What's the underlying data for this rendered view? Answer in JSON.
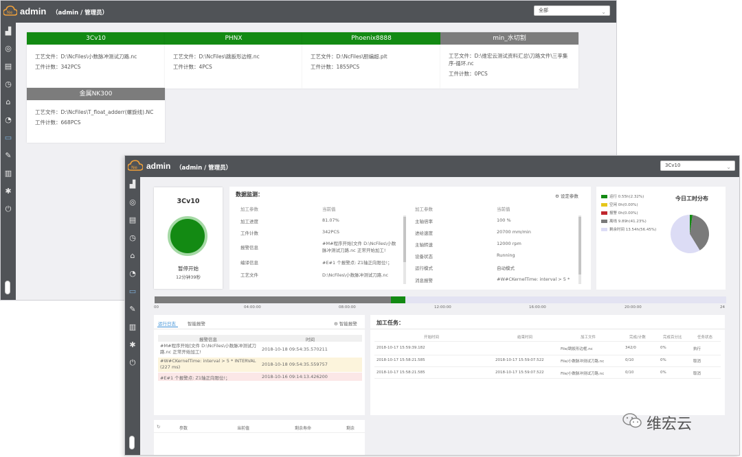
{
  "back": {
    "brand": "admin",
    "user_role": "（admin / 管理员）",
    "filter_value": "全部",
    "machines": [
      {
        "name": "3Cv10",
        "color": "#138a13",
        "file": "工艺文件：D:\\NcFiles\\小数脉冲测试刀路.nc",
        "count": "工件计数：342PCS"
      },
      {
        "name": "PHNX",
        "color": "#138a13",
        "file": "工艺文件：D:\\NcFiles\\跳扳形边框.nc",
        "count": "工件计数：4PCS"
      },
      {
        "name": "Phoenix8888",
        "color": "#138a13",
        "file": "工艺文件：D:\\NcFiles\\胆编超.plt",
        "count": "工件计数：1855PCS"
      },
      {
        "name": "min_水切割",
        "color": "#7c7c7c",
        "file": "工艺文件：D:\\维宏云测试资料汇总\\刀路文件\\三孪集序-循环.nc",
        "count": "工件计数：0PCS"
      },
      {
        "name": "金属NK300",
        "color": "#7c7c7c",
        "file": "工艺文件：D:\\NcFiles\\T_float_adderr(螺旋线).NC",
        "count": "工件计数：668PCS"
      }
    ]
  },
  "front": {
    "brand": "admin",
    "user_role": "（admin / 管理员）",
    "machine_select": "3Cv10",
    "machine_name": "3Cv10",
    "status_text": "暂停开始",
    "status_time": "12分钟39秒",
    "status_color": "#138a13",
    "monitor_title": "数据监测：",
    "settings_label": "设定参数",
    "left_table": {
      "headers": [
        "加工参数",
        "当前值"
      ],
      "rows": [
        [
          "加工进度",
          "81.07%"
        ],
        [
          "工件计数",
          "342PCS"
        ],
        [
          "报警信息",
          "#M#程序开始[文件 D:\\NcFiles\\小数脉冲测试刀路.nc 正常开始加工!"
        ],
        [
          "编译信息",
          "#E#1 个报警点: Z1轴正向限位!；"
        ],
        [
          "工艺文件",
          "D:\\NcFiles\\小数脉冲测试刀路.nc"
        ]
      ]
    },
    "right_table": {
      "headers": [
        "加工参数",
        "当前值"
      ],
      "rows": [
        [
          "主轴倍率",
          "100 %"
        ],
        [
          "进给速度",
          "20700 mm/min"
        ],
        [
          "主轴转速",
          "12000 rpm"
        ],
        [
          "设备状态",
          "Running"
        ],
        [
          "运行模式",
          "自动模式"
        ],
        [
          "消息报警",
          "#W#CKernelTime: interval > 5 *"
        ]
      ]
    },
    "pie": {
      "title": "今日工时分布",
      "legend": [
        {
          "label": "运行 0.55h(2.32%)",
          "color": "#138a13"
        },
        {
          "label": "空闲 0h(0.00%)",
          "color": "#e6c619"
        },
        {
          "label": "报警 0h(0.00%)",
          "color": "#c0262d"
        },
        {
          "label": "离线 9.89h(41.23%)",
          "color": "#7a7a7a"
        },
        {
          "label": "剩余时间 13.54h(56.45%)",
          "color": "#dcdcf5"
        }
      ]
    },
    "timeline": {
      "ticks": [
        "00",
        "04:00:00",
        "08:00:00",
        "12:00:00",
        "16:00:00",
        "20:00:00",
        "24"
      ]
    },
    "tabs": {
      "active": "运行日志",
      "inactive": "智能报警",
      "alarm_btn": "智能报警"
    },
    "log_table": {
      "headers": [
        "报警信息",
        "时间"
      ],
      "rows": [
        {
          "msg": "#M#程序开始[文件 D:\\NcFiles\\小数脉冲测试刀路.nc 正常开始加工!",
          "time": "2018-10-18 09:54:35.570211",
          "bg": "#ffffff"
        },
        {
          "msg": "#W#CKernelTime: interval > 5 * INTERVAL (227 ms)",
          "time": "2018-10-18 09:54:35.559757",
          "bg": "#fcf4dc"
        },
        {
          "msg": "#E#1 个报警点: Z1轴正向限位!；",
          "time": "2018-10-16 09:14:13.426200",
          "bg": "#fbe7e7"
        }
      ]
    },
    "task": {
      "title": "加工任务：",
      "headers": [
        "开始时间",
        "结束时间",
        "加工文件",
        "完成/计数",
        "完成百分比",
        "任务状态"
      ],
      "rows": [
        [
          "2018-10-17 15:59:39.182",
          "",
          "File/跳扳形边框.nc",
          "342/0",
          "0%",
          "执行"
        ],
        [
          "2018-10-17 15:58:21.585",
          "2018-10-17 15:59:07.522",
          "File/小数脉冲测试刀路.nc",
          "0/10",
          "0%",
          "取消"
        ],
        [
          "2018-10-17 15:58:21.585",
          "2018-10-17 15:59:07.522",
          "File/小数脉冲测试刀路.nc",
          "0/10",
          "0%",
          "取消"
        ]
      ]
    },
    "bottom_headers": [
      "参数",
      "当前值",
      "剩余寿命",
      "剩余"
    ]
  },
  "watermark": "维宏云"
}
